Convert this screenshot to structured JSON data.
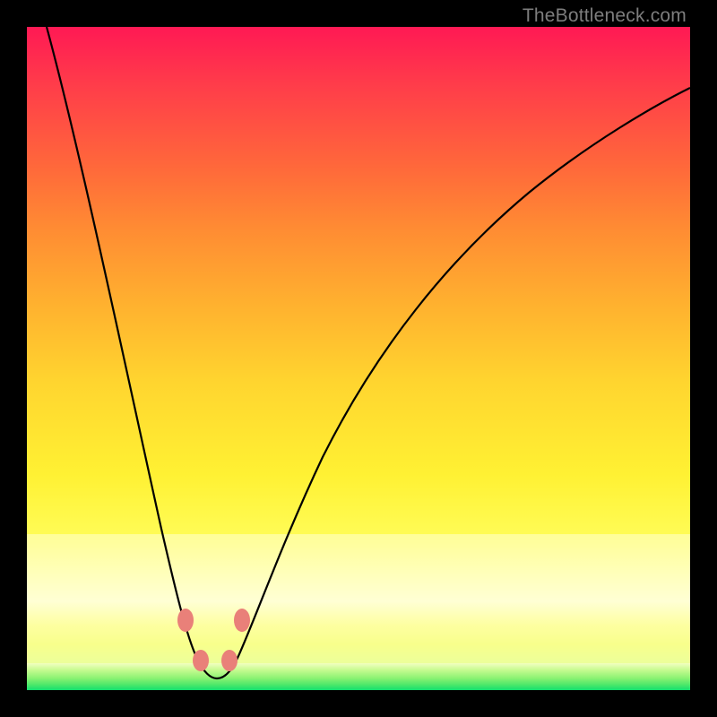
{
  "watermark": "TheBottleneck.com",
  "chart_data": {
    "type": "line",
    "title": "",
    "xlabel": "",
    "ylabel": "",
    "xlim": [
      0,
      100
    ],
    "ylim": [
      0,
      100
    ],
    "grid": false,
    "series": [
      {
        "name": "bottleneck-curve",
        "x": [
          3,
          6,
          10,
          14,
          18,
          21,
          24,
          26,
          28,
          30,
          32,
          35,
          38,
          42,
          48,
          55,
          63,
          72,
          82,
          92,
          100
        ],
        "y": [
          100,
          86,
          70,
          54,
          38,
          24,
          12,
          5,
          2,
          2,
          4,
          12,
          24,
          38,
          52,
          63,
          72,
          79,
          84,
          88,
          90
        ]
      }
    ],
    "markers": [
      {
        "x": 24.5,
        "y": 10
      },
      {
        "x": 26.0,
        "y": 4
      },
      {
        "x": 30.0,
        "y": 4
      },
      {
        "x": 31.5,
        "y": 10
      }
    ],
    "marker_color": "#e98079",
    "background_gradient": [
      "#ff1954",
      "#ffd52f",
      "#ffffd2",
      "#13df6e"
    ]
  }
}
